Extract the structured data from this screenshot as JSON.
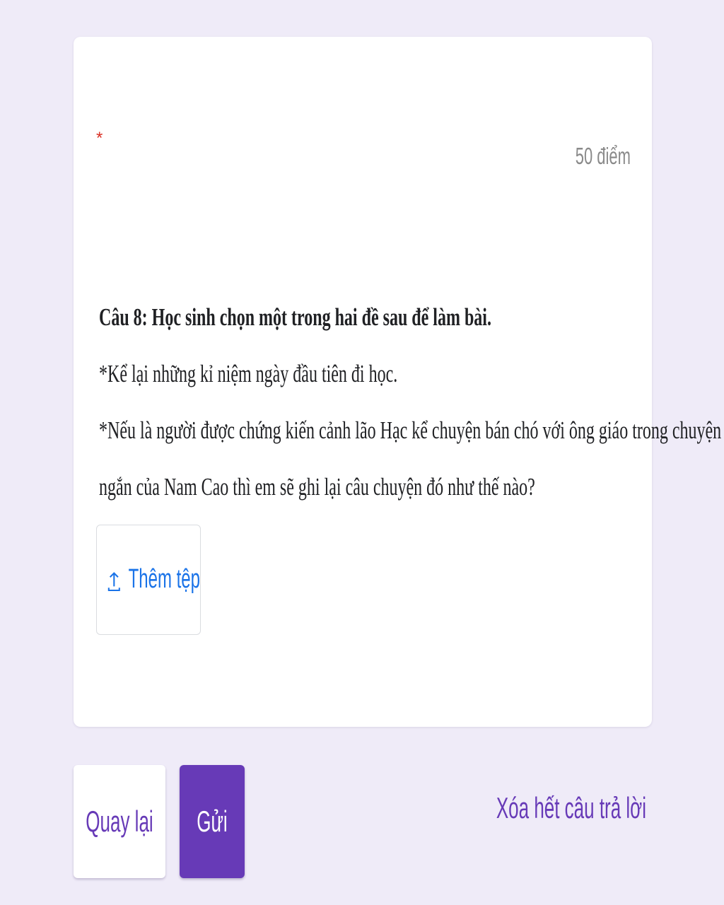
{
  "question": {
    "required_marker": "*",
    "points": "50 điểm",
    "title": "Câu 8: Học sinh chọn một trong hai đề sau để làm bài.",
    "option_1": "*Kể lại những kỉ niệm ngày đầu tiên đi học.",
    "option_2_line_1": "*Nếu là người được chứng kiến cảnh lão Hạc kể chuyện bán chó với ông giáo trong chuyện",
    "option_2_line_2": "ngắn của Nam Cao thì em sẽ ghi lại câu chuyện đó như thế nào?",
    "upload_label": "Thêm tệp",
    "upload_icon": "upload-icon"
  },
  "footer": {
    "back_label": "Quay lại",
    "submit_label": "Gửi",
    "clear_label": "Xóa hết câu trả lời"
  },
  "colors": {
    "background": "#efebf8",
    "accent": "#673ab7",
    "link_blue": "#1a73e8",
    "required_red": "#d93025"
  }
}
